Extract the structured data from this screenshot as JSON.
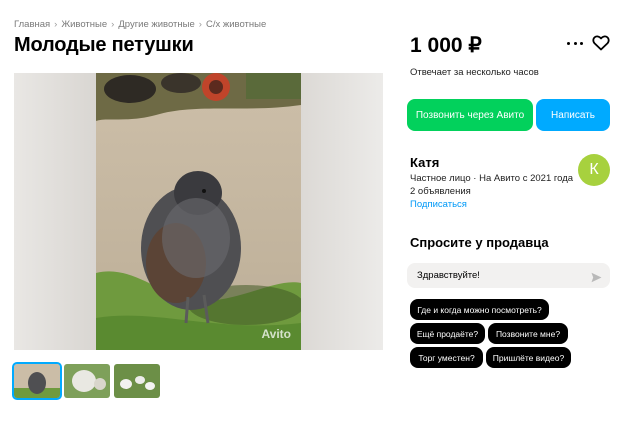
{
  "breadcrumb": {
    "items": [
      "Главная",
      "Животные",
      "Другие животные",
      "С/х животные"
    ],
    "separator": "›"
  },
  "listing": {
    "title": "Молодые петушки",
    "price": "1 000 ₽",
    "response_time": "Отвечает за несколько часов",
    "photo_watermark": "Avito",
    "photo_count": 3
  },
  "actions": {
    "call_label": "Позвонить через Авито",
    "write_label": "Написать",
    "call_color": "#02d15c",
    "write_color": "#00aaff"
  },
  "seller": {
    "name": "Катя",
    "since": "Частное лицо · На Авито с 2021 года",
    "ads": "2 объявления",
    "subscribe_label": "Подписаться",
    "avatar_letter": "К",
    "avatar_color": "#a7d13e"
  },
  "ask": {
    "title": "Спросите у продавца",
    "input_value": "Здравствуйте!",
    "chips": [
      "Где и когда можно посмотреть?",
      "Ещё продаёте?",
      "Позвоните мне?",
      "Торг уместен?",
      "Пришлёте видео?"
    ]
  },
  "icons": {
    "more": "more-icon",
    "favorite": "heart-icon",
    "send": "send-icon"
  }
}
